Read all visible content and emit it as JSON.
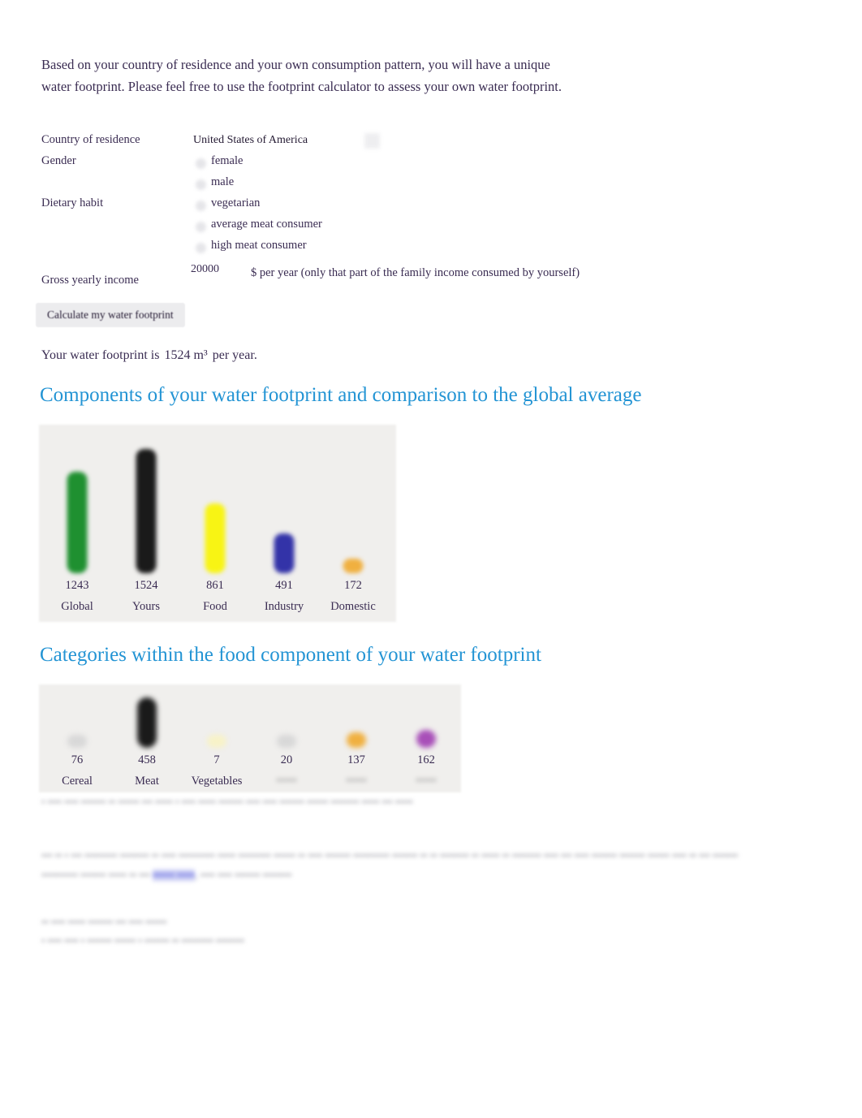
{
  "intro": {
    "text": "Based on your country of residence and your own consumption pattern, you will have a unique water footprint. Please feel free to use the footprint calculator to assess your own water footprint."
  },
  "form": {
    "country": {
      "label": "Country of residence",
      "value": "United States of America"
    },
    "gender": {
      "label": "Gender",
      "options": [
        "female",
        "male"
      ]
    },
    "diet": {
      "label": "Dietary habit",
      "options": [
        "vegetarian",
        "average meat consumer",
        "high meat consumer"
      ]
    },
    "income": {
      "label": "Gross yearly income",
      "value": "20000",
      "suffix": "$ per year (only that part of the family income consumed by yourself)"
    },
    "submit_label": "Calculate my water footprint"
  },
  "result": {
    "prefix": "Your water footprint is",
    "value": "1524 m³",
    "suffix": "per year."
  },
  "headings": {
    "components": "Components of your water footprint and comparison to the global average",
    "categories": "Categories within the food component of your water footprint"
  },
  "chart_data": [
    {
      "type": "bar",
      "title": "Components of your water footprint and comparison to the global average",
      "xlabel": "",
      "ylabel": "",
      "ylim": [
        0,
        1524
      ],
      "grid": false,
      "legend": "none",
      "categories": [
        "Global",
        "Yours",
        "Food",
        "Industry",
        "Domestic"
      ],
      "values": [
        1243,
        1524,
        861,
        491,
        172
      ],
      "colors": [
        "#1f9030",
        "#1a1a1a",
        "#f8f414",
        "#3333a8",
        "#f0b040"
      ]
    },
    {
      "type": "bar",
      "title": "Categories within the food component of your water footprint",
      "xlabel": "",
      "ylabel": "",
      "ylim": [
        0,
        458
      ],
      "grid": false,
      "legend": "none",
      "categories": [
        "Cereal",
        "Meat",
        "Vegetables",
        "",
        "",
        ""
      ],
      "categories_legible": [
        true,
        true,
        true,
        false,
        false,
        false
      ],
      "values": [
        76,
        458,
        7,
        20,
        137,
        162
      ],
      "colors": [
        "#d8d8d8",
        "#1a1a1a",
        "#f7f2c8",
        "#d8d8d8",
        "#f0b040",
        "#a84fb8"
      ]
    }
  ],
  "blurred": {
    "note": "• •••• •••• ••••••• •• •••••• ••• ••••• • •••• ••••• ••••••• •••• •••• ••••••• •••••• •••••••• ••••• ••• •••••",
    "paragraph_part1": "••• •• • ••• ••••••••• •••••••• •• •••• •••••••••• ••••• ••••••••• •••••• •• •••• ••••••• •••••••••• ••••••• •• •• •••••••• •• ••••• •• •••••••• •••• ••• •••• ••••••• ••••••• •••••• •••• •• ••• ••••••• •••••••••• ••••••• ••••• •• •••",
    "paragraph_link": "•••••• •••••",
    "paragraph_part2": ", •••• •••• ••••••• ••••••••",
    "footer_line1": "•• •••• ••••• ••••••• ••• •••• ••••••",
    "footer_line2": "• •••• •••• • ••••••• •••••• • ••••••• •• ••••••••• ••••••••"
  }
}
